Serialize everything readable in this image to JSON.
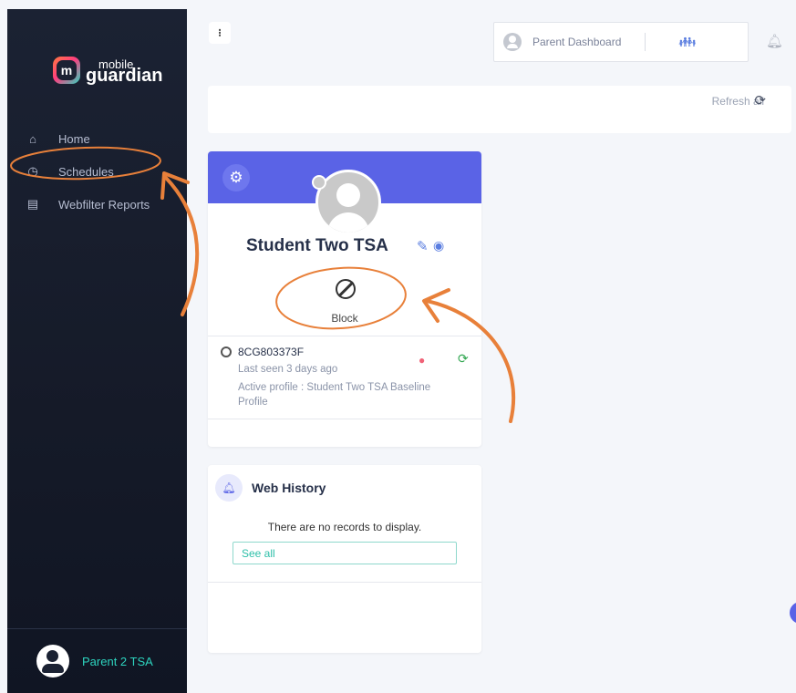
{
  "sidebar": {
    "logo": {
      "line1": "mobile",
      "line2": "guardian",
      "badge": "m"
    },
    "items": [
      {
        "label": "Home",
        "icon": "home-icon"
      },
      {
        "label": "Schedules",
        "icon": "clock-icon"
      },
      {
        "label": "Webfilter Reports",
        "icon": "report-icon"
      }
    ],
    "footer_user": "Parent 2 TSA"
  },
  "topbar": {
    "menu_glyph": "⁝",
    "dashboard_label": "Parent Dashboard",
    "kids_icon": "family-icon",
    "bell_icon": "bell-icon"
  },
  "refresh": {
    "label": "Refresh all",
    "icon": "refresh-icon"
  },
  "student_card": {
    "name": "Student Two TSA",
    "block_label": "Block",
    "device": {
      "id": "8CG803373F",
      "last_seen": "Last seen 3 days ago",
      "active_profile": "Active profile : Student Two TSA Baseline Profile"
    }
  },
  "web_history": {
    "title": "Web History",
    "empty_text": "There are no records to display.",
    "see_all": "See all"
  },
  "colors": {
    "accent": "#5a63e6",
    "teal": "#2dd4bf",
    "annotation": "#e8803a"
  }
}
